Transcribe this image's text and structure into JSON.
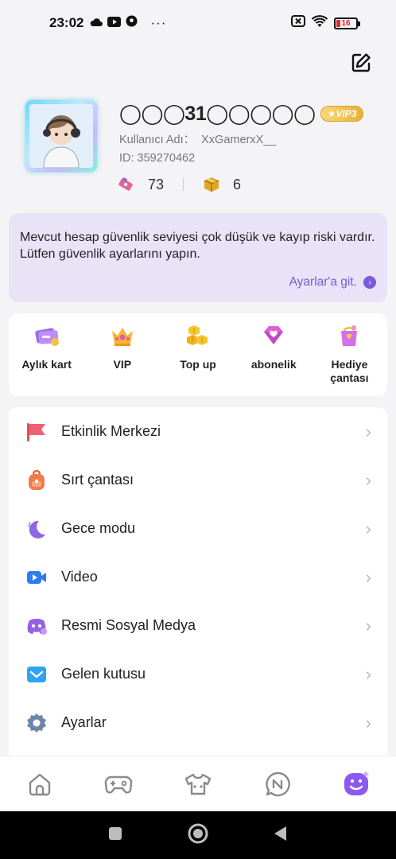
{
  "status_bar": {
    "time": "23:02",
    "more": "···",
    "battery": "16"
  },
  "profile": {
    "name": "◯◯◯31◯◯◯◯◯",
    "vip": "★VIP3",
    "username_label": "Kullanıcı Adı：",
    "username": "XxGamerxX__",
    "id": "ID: 359270462",
    "tickets": "73",
    "boxes": "6"
  },
  "security": {
    "message": "Mevcut hesap güvenlik seviyesi çok düşük ve kayıp riski vardır. Lütfen güvenlik ayarlarını yapın.",
    "link": "Ayarlar'a git."
  },
  "quick_actions": [
    {
      "label": "Aylık kart",
      "icon": "card-icon"
    },
    {
      "label": "VIP",
      "icon": "crown-icon"
    },
    {
      "label": "Top up",
      "icon": "coins-icon"
    },
    {
      "label": "abonelik",
      "icon": "heart-gem-icon"
    },
    {
      "label": "Hediye çantası",
      "icon": "gift-bag-icon"
    }
  ],
  "menu": [
    {
      "label": "Etkinlik Merkezi",
      "icon": "flag-icon"
    },
    {
      "label": "Sırt çantası",
      "icon": "backpack-icon"
    },
    {
      "label": "Gece modu",
      "icon": "moon-icon"
    },
    {
      "label": "Video",
      "icon": "video-camera-icon"
    },
    {
      "label": "Resmi Sosyal Medya",
      "icon": "discord-icon"
    },
    {
      "label": "Gelen kutusu",
      "icon": "mail-icon"
    },
    {
      "label": "Ayarlar",
      "icon": "gear-icon"
    }
  ],
  "bottom_nav": [
    {
      "icon": "home-icon"
    },
    {
      "icon": "gamepad-icon"
    },
    {
      "icon": "shirt-icon"
    },
    {
      "icon": "news-icon"
    },
    {
      "icon": "profile-face-icon",
      "active": true
    }
  ],
  "colors": {
    "accent": "#7c5ad8",
    "security_bg": "#e8e3f7",
    "background": "#f4f4f6"
  }
}
